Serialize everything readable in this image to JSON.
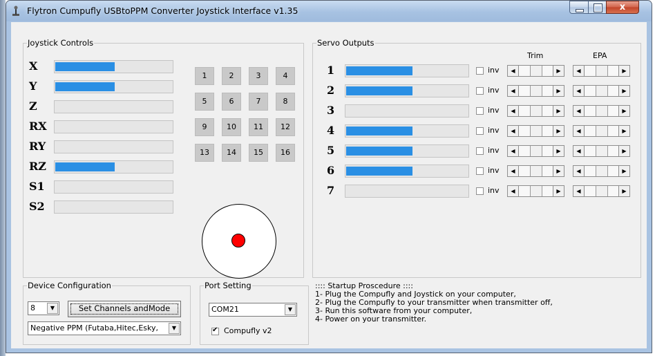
{
  "window": {
    "title": "Flytron Cumpufly USBtoPPM Converter Joystick Interface v1.35",
    "close_label": "x"
  },
  "joystick": {
    "group_label": "Joystick Controls",
    "axes": [
      {
        "label": "X",
        "value": 0.5
      },
      {
        "label": "Y",
        "value": 0.5
      },
      {
        "label": "Z",
        "value": 0.0
      },
      {
        "label": "RX",
        "value": 0.0
      },
      {
        "label": "RY",
        "value": 0.0
      },
      {
        "label": "RZ",
        "value": 0.5
      },
      {
        "label": "S1",
        "value": 0.0
      },
      {
        "label": "S2",
        "value": 0.0
      }
    ],
    "buttons": [
      "1",
      "2",
      "3",
      "4",
      "5",
      "6",
      "7",
      "8",
      "9",
      "10",
      "11",
      "12",
      "13",
      "14",
      "15",
      "16"
    ],
    "hat": {
      "x": 0.0,
      "y": 0.0,
      "dot_color": "#ff0000"
    }
  },
  "servo": {
    "group_label": "Servo Outputs",
    "trim_label": "Trim",
    "epa_label": "EPA",
    "inv_label": "inv",
    "channels": [
      {
        "label": "1",
        "value": 0.54,
        "inv": false
      },
      {
        "label": "2",
        "value": 0.54,
        "inv": false
      },
      {
        "label": "3",
        "value": 0.0,
        "inv": false
      },
      {
        "label": "4",
        "value": 0.54,
        "inv": false
      },
      {
        "label": "5",
        "value": 0.54,
        "inv": false
      },
      {
        "label": "6",
        "value": 0.54,
        "inv": false
      },
      {
        "label": "7",
        "value": 0.0,
        "inv": false
      }
    ]
  },
  "device": {
    "group_label": "Device Configuration",
    "channels_value": "8",
    "set_button": "Set Channels andMode",
    "mode_value": "Negative PPM (Futaba,Hitec,Esky,"
  },
  "port": {
    "group_label": "Port Setting",
    "port_value": "COM21",
    "compufly_label": "Compufly v2",
    "compufly_checked": true,
    "check_glyph": "✔"
  },
  "startup": {
    "lines": [
      ":::: Startup Proscedure ::::",
      "1- Plug the Compufly and Joystick on your computer,",
      "2- Plug the Compufly to your transmitter when transmitter off,",
      "3- Run this software from your computer,",
      "4- Power on your transmitter."
    ]
  },
  "colors": {
    "bar_fill": "#2a8fe4",
    "window_frame": "#a9c3e2"
  }
}
